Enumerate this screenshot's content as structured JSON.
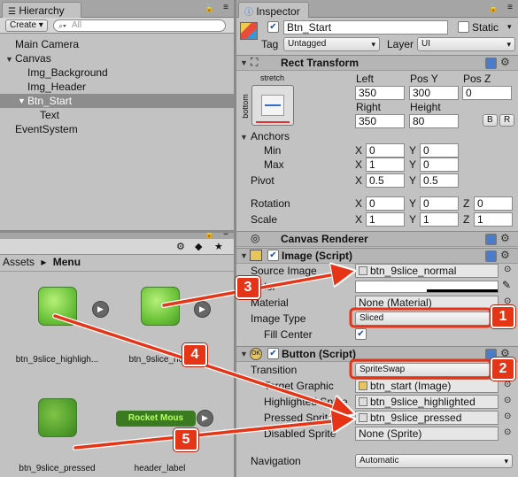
{
  "hierarchy": {
    "tab_label": "Hierarchy",
    "create_label": "Create",
    "search_placeholder": "All",
    "items": [
      "Main Camera",
      "Canvas",
      "Img_Background",
      "Img_Header",
      "Btn_Start",
      "Text",
      "EventSystem"
    ]
  },
  "project": {
    "breadcrumb_root": "Assets",
    "breadcrumb_sep": "▸",
    "breadcrumb_current": "Menu",
    "assets": [
      {
        "label": "btn_9slice_highligh..."
      },
      {
        "label": "btn_9slice_no..."
      },
      {
        "label": "btn_9slice_pressed"
      },
      {
        "label": "header_label"
      }
    ],
    "header_label_art": "Rocket Mous"
  },
  "inspector": {
    "tab_label": "Inspector",
    "object_name": "Btn_Start",
    "static_label": "Static",
    "tag_label": "Tag",
    "tag_value": "Untagged",
    "layer_label": "Layer",
    "layer_value": "UI",
    "rect_transform": {
      "title": "Rect Transform",
      "anchor_preset_top": "stretch",
      "anchor_preset_side": "bottom",
      "left_label": "Left",
      "left_value": "350",
      "posy_label": "Pos Y",
      "posy_value": "300",
      "posz_label": "Pos Z",
      "posz_value": "0",
      "right_label": "Right",
      "right_value": "350",
      "height_label": "Height",
      "height_value": "80",
      "b_label": "B",
      "r_label": "R",
      "anchors_label": "Anchors",
      "min_label": "Min",
      "min_x": "0",
      "min_y": "0",
      "max_label": "Max",
      "max_x": "1",
      "max_y": "0",
      "pivot_label": "Pivot",
      "pivot_x": "0.5",
      "pivot_y": "0.5",
      "rotation_label": "Rotation",
      "rot_x": "0",
      "rot_y": "0",
      "rot_z": "0",
      "scale_label": "Scale",
      "scale_x": "1",
      "scale_y": "1",
      "scale_z": "1",
      "x": "X",
      "y": "Y",
      "z": "Z"
    },
    "canvas_renderer": {
      "title": "Canvas Renderer"
    },
    "image": {
      "title": "Image (Script)",
      "source_image_label": "Source Image",
      "source_image_value": "btn_9slice_normal",
      "color_label": "Color",
      "material_label": "Material",
      "material_value": "None (Material)",
      "image_type_label": "Image Type",
      "image_type_value": "Sliced",
      "fill_center_label": "Fill Center"
    },
    "button": {
      "title": "Button (Script)",
      "transition_label": "Transition",
      "transition_value": "SpriteSwap",
      "target_graphic_label": "Target Graphic",
      "target_graphic_value": "btn_start (Image)",
      "highlighted_label": "Highlighted Sprite",
      "highlighted_value": "btn_9slice_highlighted",
      "pressed_label": "Pressed Sprite",
      "pressed_value": "btn_9slice_pressed",
      "disabled_label": "Disabled Sprite",
      "disabled_value": "None (Sprite)",
      "navigation_label": "Navigation",
      "navigation_value": "Automatic"
    }
  },
  "callouts": [
    "1",
    "2",
    "3",
    "4",
    "5"
  ],
  "colors": {
    "callout": "#e53416",
    "panel": "#c2c2c2",
    "selection": "#8d8d8d"
  }
}
